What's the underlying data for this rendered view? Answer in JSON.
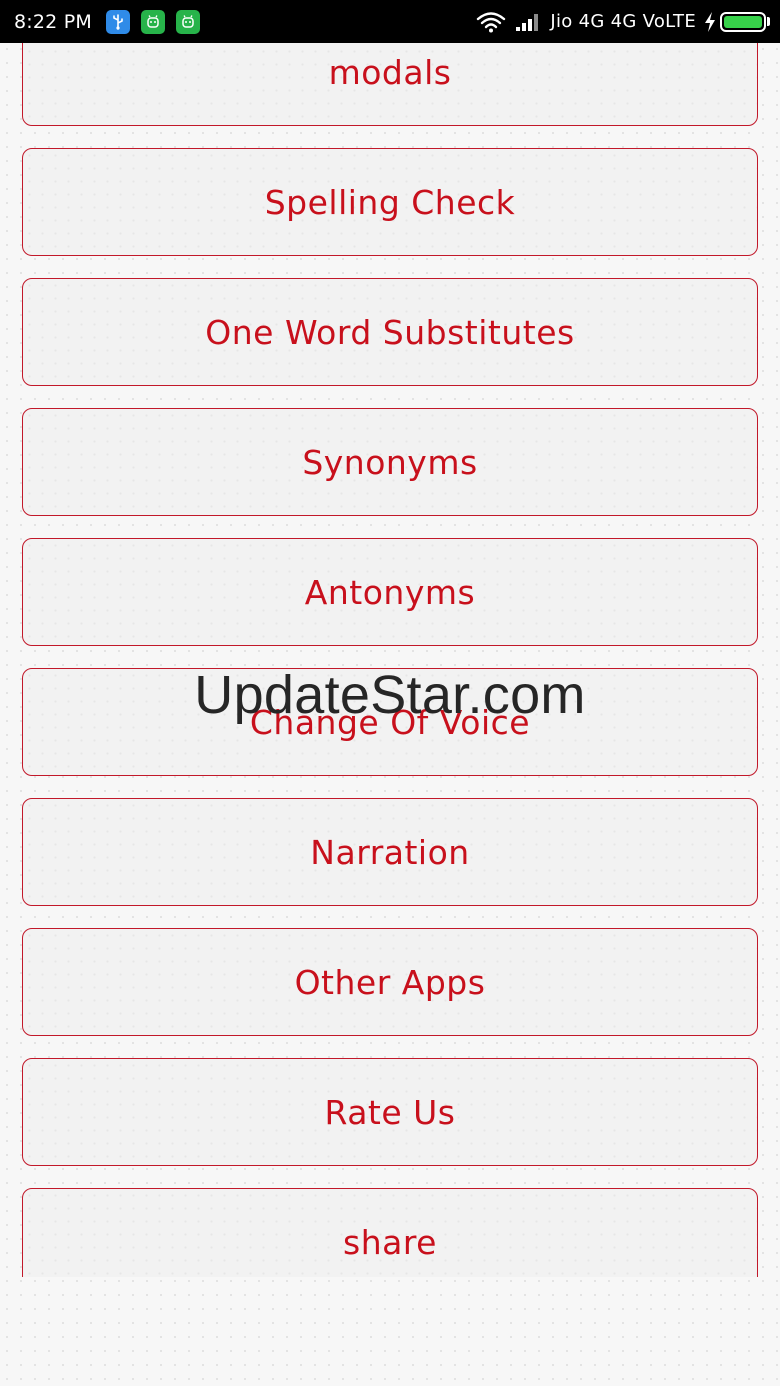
{
  "status_bar": {
    "time": "8:22 PM",
    "network": "Jio 4G 4G VoLTE",
    "icons": [
      "usb-icon",
      "robot-icon",
      "robot-icon",
      "wifi-icon",
      "signal-icon",
      "charging-icon",
      "battery-icon"
    ],
    "colors": {
      "usb_badge": "#2f8be8",
      "notification_badge": "#27b34a",
      "battery_fill": "#37d24a"
    }
  },
  "menu": {
    "items": [
      {
        "label": "modals"
      },
      {
        "label": "Spelling Check"
      },
      {
        "label": "One Word Substitutes"
      },
      {
        "label": "Synonyms"
      },
      {
        "label": "Antonyms"
      },
      {
        "label": "Change Of Voice"
      },
      {
        "label": "Narration"
      },
      {
        "label": "Other Apps"
      },
      {
        "label": "Rate Us"
      },
      {
        "label": "share"
      }
    ],
    "colors": {
      "label": "#c8101c",
      "border": "#c2182a",
      "fill": "#f2f2f2"
    }
  },
  "watermark": {
    "text": "UpdateStar.com"
  }
}
